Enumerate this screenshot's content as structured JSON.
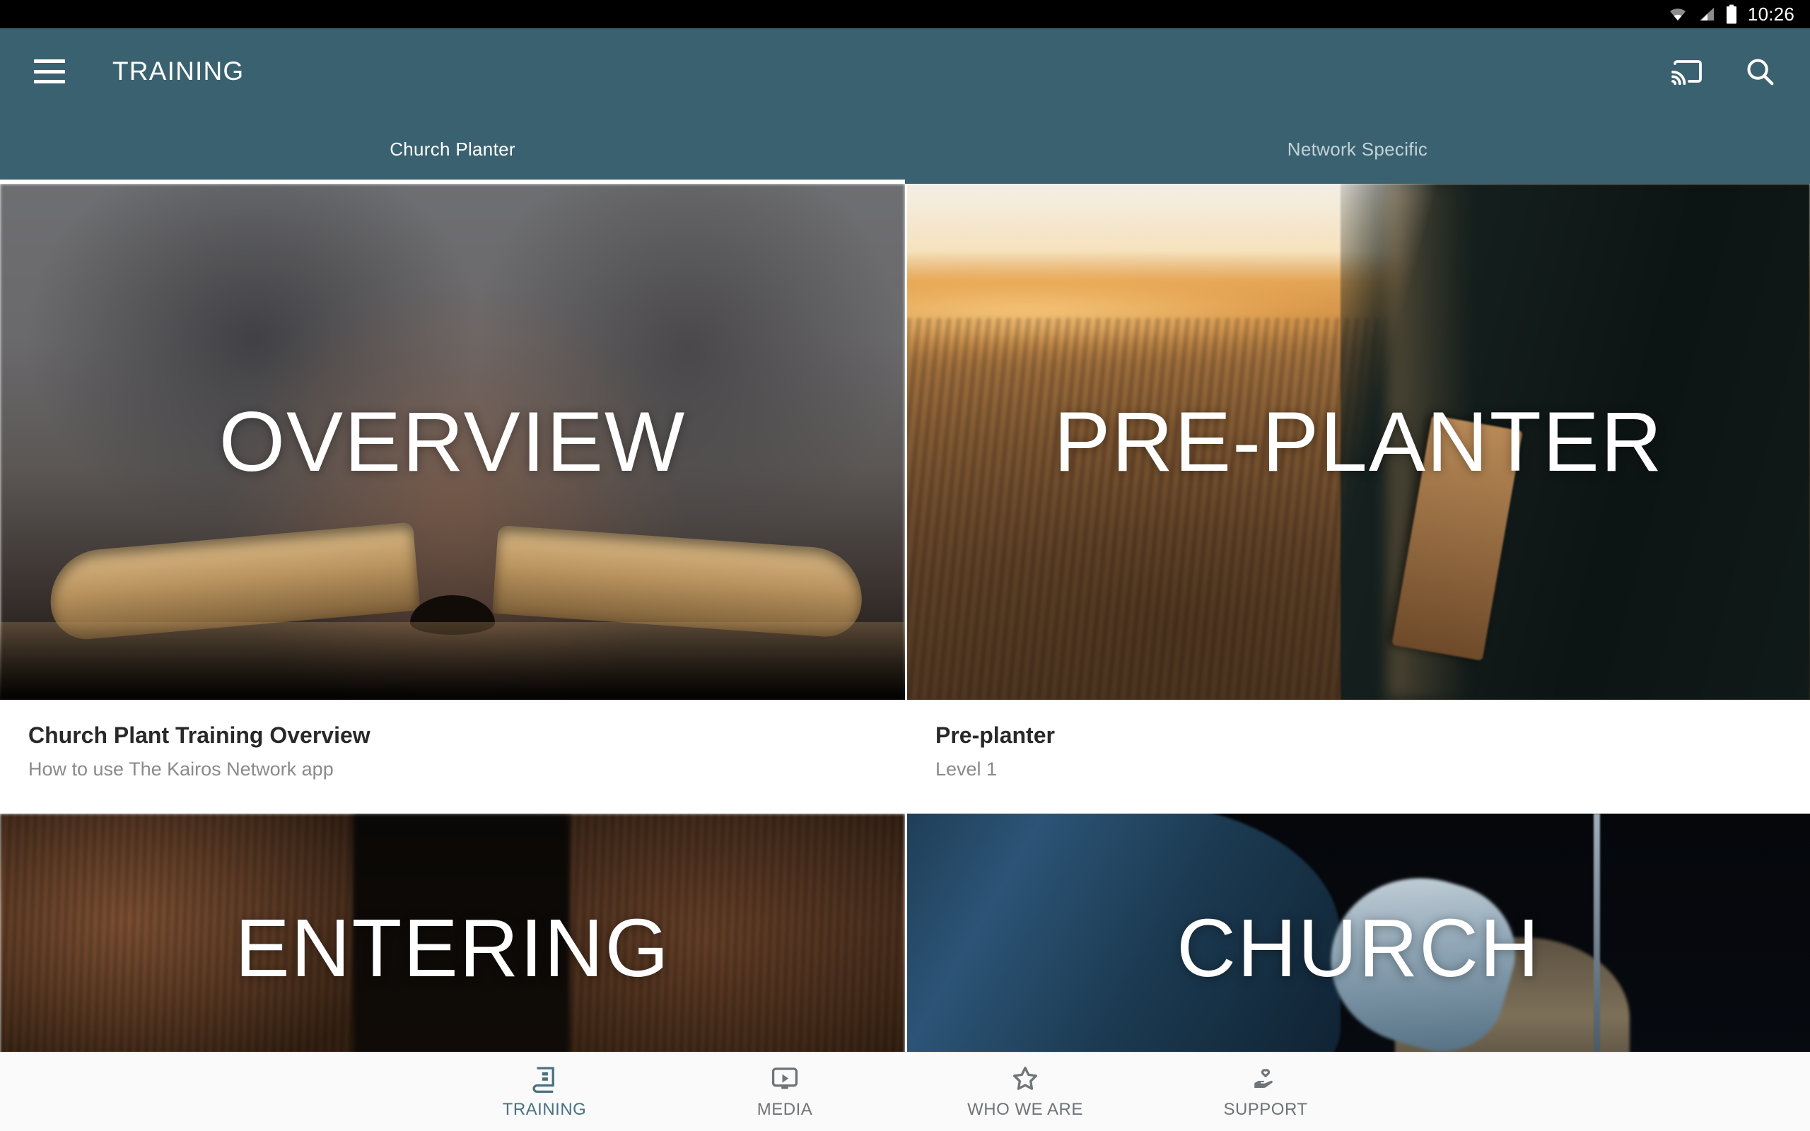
{
  "status_bar": {
    "time": "10:26",
    "icons": [
      "wifi-icon",
      "cellular-signal-icon",
      "battery-icon"
    ]
  },
  "app_bar": {
    "menu_icon": "hamburger-menu-icon",
    "title": "TRAINING",
    "actions": [
      {
        "icon": "cast-icon",
        "name": "cast-button"
      },
      {
        "icon": "search-icon",
        "name": "search-button"
      }
    ],
    "background_color": "#3a6170"
  },
  "tabs": {
    "items": [
      {
        "label": "Church Planter",
        "active": true
      },
      {
        "label": "Network Specific",
        "active": false
      }
    ],
    "indicator_color": "#ffffff"
  },
  "cards": [
    {
      "hero_text": "OVERVIEW",
      "title": "Church Plant Training Overview",
      "subtitle": "How to use The Kairos Network app"
    },
    {
      "hero_text": "PRE-PLANTER",
      "title": "Pre-planter",
      "subtitle": "Level 1"
    },
    {
      "hero_text": "ENTERING",
      "title": "",
      "subtitle": ""
    },
    {
      "hero_text": "CHURCH",
      "title": "",
      "subtitle": ""
    }
  ],
  "bottom_nav": {
    "items": [
      {
        "label": "TRAINING",
        "icon": "book-icon",
        "active": true
      },
      {
        "label": "MEDIA",
        "icon": "video-monitor-icon",
        "active": false
      },
      {
        "label": "WHO WE ARE",
        "icon": "star-icon",
        "active": false
      },
      {
        "label": "SUPPORT",
        "icon": "hand-heart-icon",
        "active": false
      }
    ],
    "active_color": "#4a7280",
    "inactive_color": "#6f7478"
  }
}
